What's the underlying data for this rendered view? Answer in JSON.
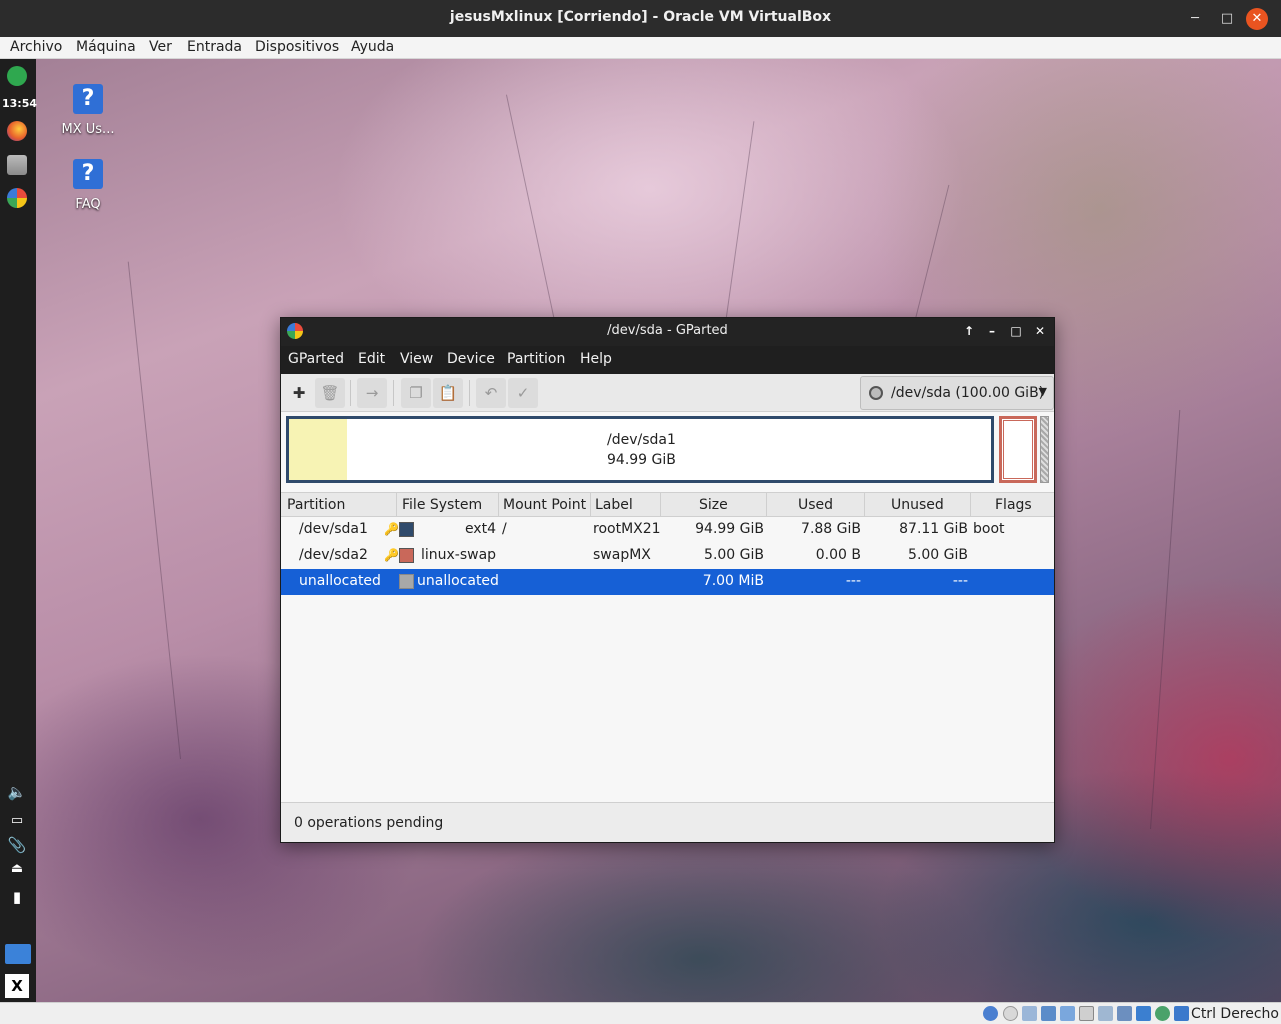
{
  "virtualbox": {
    "title": "jesusMxlinux [Corriendo] - Oracle VM VirtualBox",
    "menu": [
      "Archivo",
      "Máquina",
      "Ver",
      "Entrada",
      "Dispositivos",
      "Ayuda"
    ],
    "host_key": "Ctrl Derecho"
  },
  "guest": {
    "clock": "13:54",
    "desktop_icons": [
      {
        "label": "MX Us...",
        "icon": "help-icon"
      },
      {
        "label": "FAQ",
        "icon": "help-icon"
      }
    ]
  },
  "gparted": {
    "title": "/dev/sda - GParted",
    "menu": [
      "GParted",
      "Edit",
      "View",
      "Device",
      "Partition",
      "Help"
    ],
    "device_selector": "/dev/sda  (100.00 GiB)",
    "graph": {
      "main_name": "/dev/sda1",
      "main_size": "94.99 GiB"
    },
    "columns": [
      "Partition",
      "File System",
      "Mount Point",
      "Label",
      "Size",
      "Used",
      "Unused",
      "Flags"
    ],
    "rows": [
      {
        "partition": "/dev/sda1",
        "filesystem": "ext4",
        "mount": "/",
        "label": "rootMX21",
        "size": "94.99 GiB",
        "used": "7.88 GiB",
        "unused": "87.11 GiB",
        "flags": "boot",
        "color": "#2f4a6b",
        "locked": true,
        "selected": false
      },
      {
        "partition": "/dev/sda2",
        "filesystem": "linux-swap",
        "mount": "",
        "label": "swapMX",
        "size": "5.00 GiB",
        "used": "0.00 B",
        "unused": "5.00 GiB",
        "flags": "",
        "color": "#c9685a",
        "locked": true,
        "selected": false
      },
      {
        "partition": "unallocated",
        "filesystem": "unallocated",
        "mount": "",
        "label": "",
        "size": "7.00 MiB",
        "used": "---",
        "unused": "---",
        "flags": "",
        "color": "#a8a8a8",
        "locked": false,
        "selected": true
      }
    ],
    "status": "0 operations pending"
  },
  "colors": {
    "selection": "#1660d6",
    "ext4": "#2f4a6b",
    "linux_swap": "#c9685a",
    "unallocated": "#a8a8a8",
    "used_space": "#f7f3b4"
  }
}
